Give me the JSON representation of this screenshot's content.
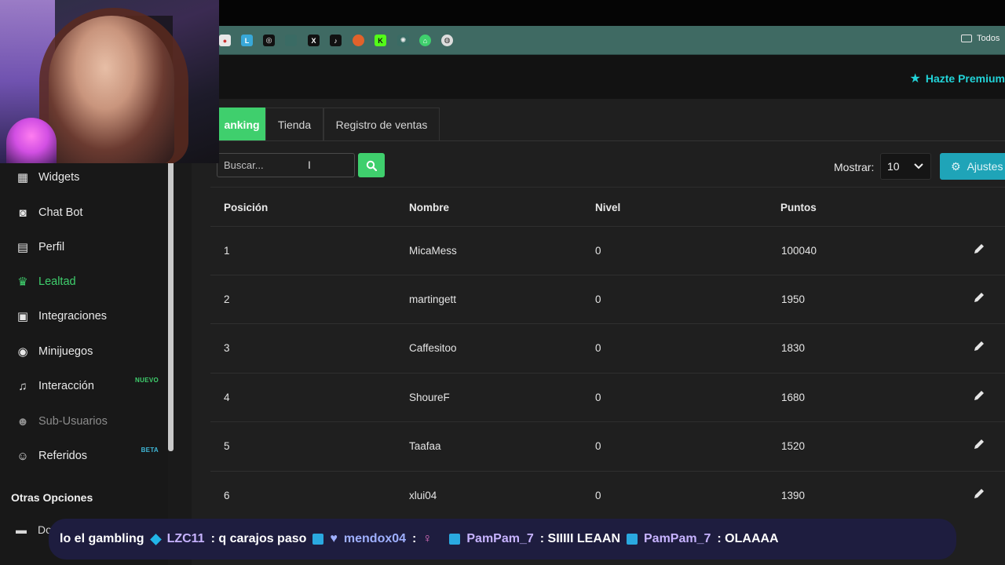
{
  "header": {
    "premium_label": "Hazte Premium"
  },
  "bookmarks": {
    "folder_label": "Todos"
  },
  "sidebar": {
    "items": [
      {
        "label": "Widgets",
        "icon": "grid-icon"
      },
      {
        "label": "Chat Bot",
        "icon": "robot-icon"
      },
      {
        "label": "Perfil",
        "icon": "id-card-icon"
      },
      {
        "label": "Lealtad",
        "icon": "trophy-icon"
      },
      {
        "label": "Integraciones",
        "icon": "discord-icon"
      },
      {
        "label": "Minijuegos",
        "icon": "gamepad-icon"
      },
      {
        "label": "Interacción",
        "icon": "music-icon",
        "badge": "NUEVO"
      },
      {
        "label": "Sub-Usuarios",
        "icon": "users-icon"
      },
      {
        "label": "Referidos",
        "icon": "user-group-icon",
        "badge": "BETA"
      }
    ],
    "section_title": "Otras Opciones",
    "docs_label": "Documentación"
  },
  "tabs": [
    {
      "label": "Ranking",
      "shown": "anking"
    },
    {
      "label": "Tienda"
    },
    {
      "label": "Registro de ventas"
    }
  ],
  "search": {
    "placeholder": "Buscar..."
  },
  "mostrar": {
    "label": "Mostrar:",
    "value": "10"
  },
  "ajustes": {
    "label": "Ajustes"
  },
  "table": {
    "columns": [
      "Posición",
      "Nombre",
      "Nivel",
      "Puntos"
    ],
    "rows": [
      {
        "pos": "1",
        "name": "MicaMess",
        "level": "0",
        "points": "100040"
      },
      {
        "pos": "2",
        "name": "martingett",
        "level": "0",
        "points": "1950"
      },
      {
        "pos": "3",
        "name": "Caffesitoo",
        "level": "0",
        "points": "1830"
      },
      {
        "pos": "4",
        "name": "ShoureF",
        "level": "0",
        "points": "1680"
      },
      {
        "pos": "5",
        "name": "Taafaa",
        "level": "0",
        "points": "1520"
      },
      {
        "pos": "6",
        "name": "xlui04",
        "level": "0",
        "points": "1390"
      }
    ]
  },
  "chat": {
    "fragment": "lo el gambling",
    "messages": [
      {
        "user": "LZC11",
        "text": ": q carajos paso"
      },
      {
        "user": "mendox04",
        "text": ":"
      },
      {
        "user": "PamPam_7",
        "text": ": SIIIII LEAAN"
      },
      {
        "user": "PamPam_7",
        "text": ": OLAAAA"
      }
    ]
  },
  "colors": {
    "accent": "#3fcf6d",
    "teal": "#1fa4b8",
    "premium": "#22d3d8"
  }
}
